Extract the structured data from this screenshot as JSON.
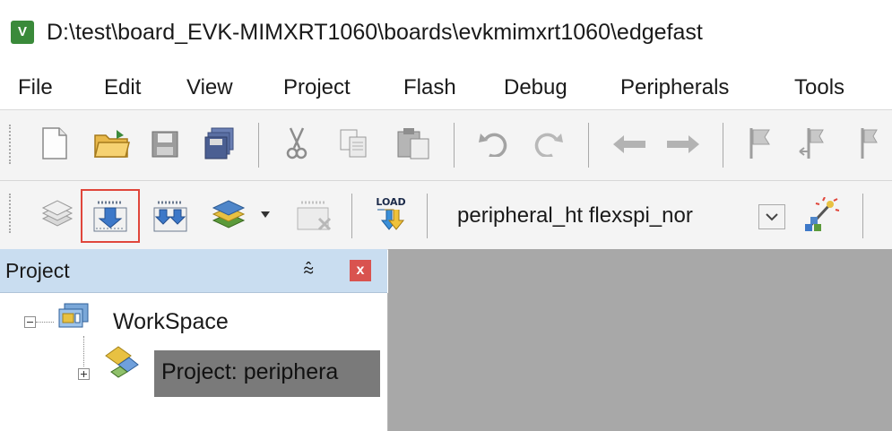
{
  "window": {
    "title": "D:\\test\\board_EVK-MIMXRT1060\\boards\\evkmimxrt1060\\edgefast",
    "app_icon": "uvision-app-icon",
    "app_icon_letter": "V"
  },
  "menu": {
    "items": [
      "File",
      "Edit",
      "View",
      "Project",
      "Flash",
      "Debug",
      "Peripherals",
      "Tools"
    ]
  },
  "build_toolbar": {
    "target_name": "peripheral_ht flexspi_nor",
    "load_label": "LOAD",
    "highlight_color": "#e0463b"
  },
  "project_panel": {
    "title": "Project",
    "pin_icon": "pin-icon",
    "close_glyph": "x",
    "tree": {
      "root_label": "WorkSpace",
      "child_label": "Project: periphera"
    }
  }
}
